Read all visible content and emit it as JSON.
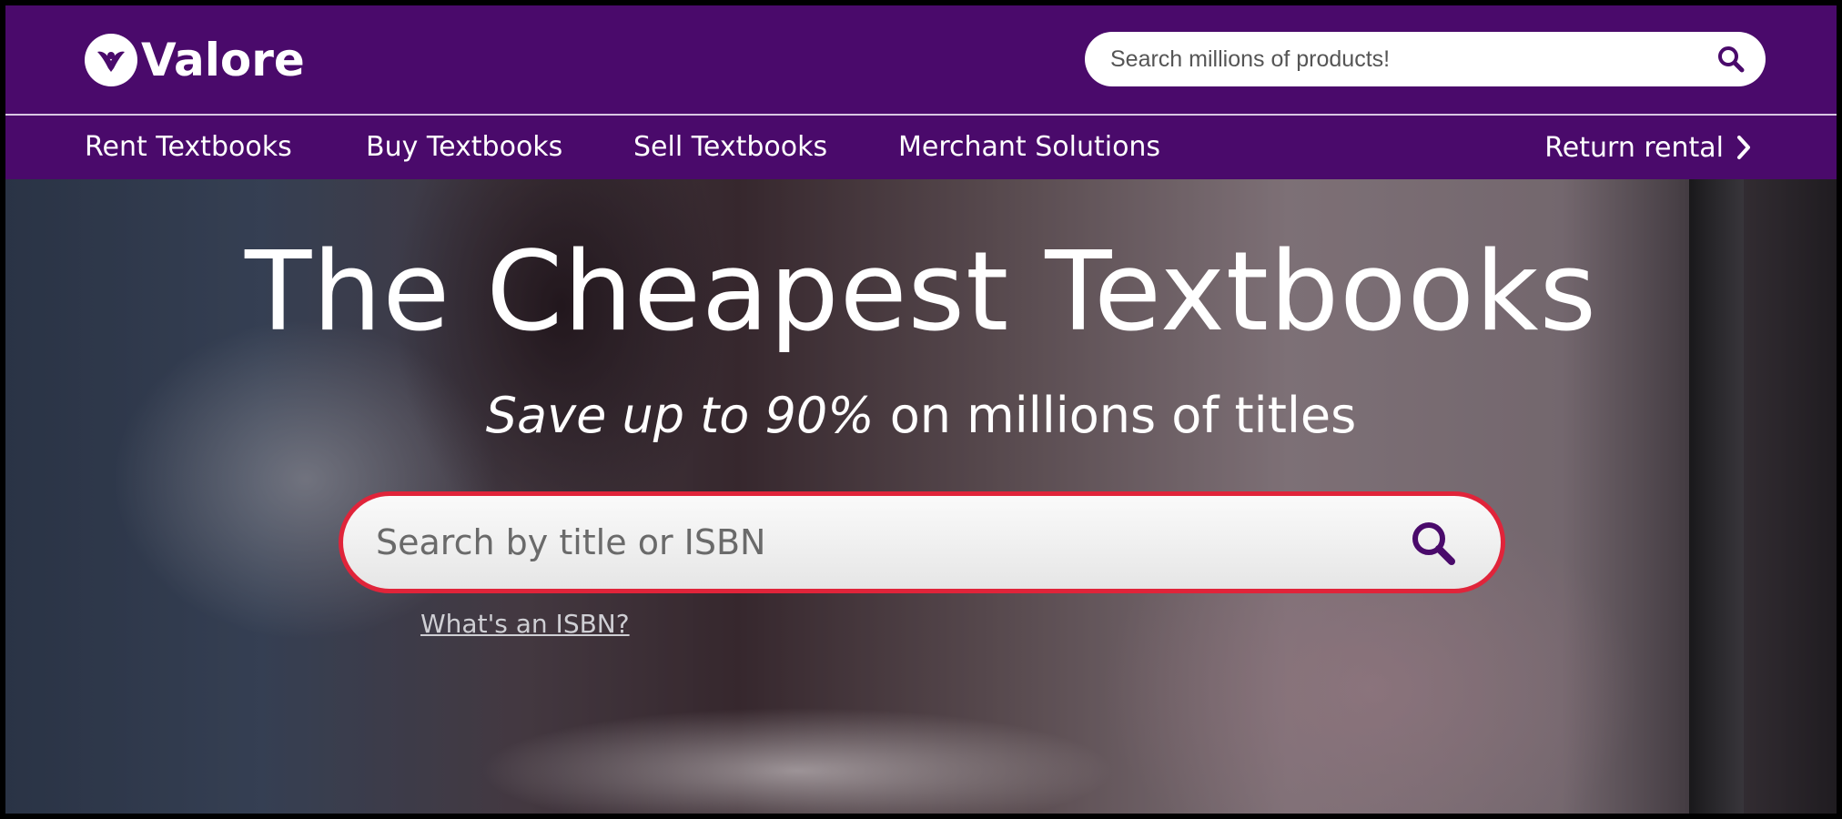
{
  "header": {
    "logo_text": "Valore",
    "search_placeholder": "Search millions of products!"
  },
  "nav": {
    "items": [
      {
        "label": "Rent Textbooks"
      },
      {
        "label": "Buy Textbooks"
      },
      {
        "label": "Sell Textbooks"
      },
      {
        "label": "Merchant Solutions"
      }
    ],
    "return_label": "Return rental"
  },
  "hero": {
    "title": "The Cheapest Textbooks",
    "subtitle_emphasis": "Save up to 90%",
    "subtitle_rest": " on millions of titles",
    "search_placeholder": "Search by title or ISBN",
    "isbn_link": "What's an ISBN?"
  },
  "colors": {
    "brand_purple": "#4a0a6b",
    "search_border_red": "#e0243a",
    "white": "#ffffff"
  },
  "icons": {
    "logo": "valore-bird-logo-icon",
    "search": "search-icon",
    "chevron": "chevron-right-icon"
  }
}
